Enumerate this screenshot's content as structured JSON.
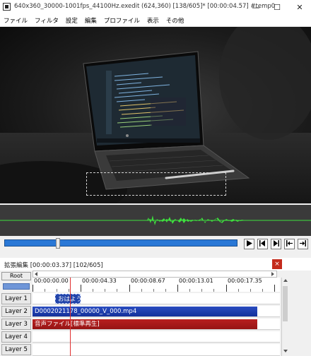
{
  "window": {
    "title": "640x360_30000-1001fps_44100Hz.exedit (624,360)  [138/605]*  [00:00:04.57]  #temp0",
    "minimize_label": "—",
    "maximize_label": "☐",
    "close_label": "✕"
  },
  "menu": [
    "ファイル",
    "フィルタ",
    "設定",
    "編集",
    "プロファイル",
    "表示",
    "その他"
  ],
  "playback": {
    "play_icon": "play-icon",
    "prev_frame_icon": "prev-frame-icon",
    "next_frame_icon": "next-frame-icon",
    "to_start_icon": "to-start-icon",
    "to_end_icon": "to-end-icon",
    "position_fraction": 0.23
  },
  "extended_edit": {
    "title": "拡張編集 [00:00:03.37] [102/605]",
    "close_label": "×",
    "root_label": "Root",
    "time_ticks": [
      "00:00:00.00",
      "00:00:04.33",
      "00:00:08.67",
      "00:00:13.01",
      "00:00:17.35"
    ],
    "layers": [
      "Layer 1",
      "Layer 2",
      "Layer 3",
      "Layer 4",
      "Layer 5"
    ],
    "clips": [
      {
        "label": "おはようご",
        "color": "#2244aa"
      },
      {
        "label": "D0002021178_00000_V_000.mp4",
        "color": "#1a3aa0"
      },
      {
        "label": "音声ファイル[標準再生]",
        "color": "#a81a1a"
      }
    ]
  },
  "colors": {
    "seekbar": "#2a78d6",
    "cursor": "#e03030",
    "waveform": "#3ee03e"
  }
}
